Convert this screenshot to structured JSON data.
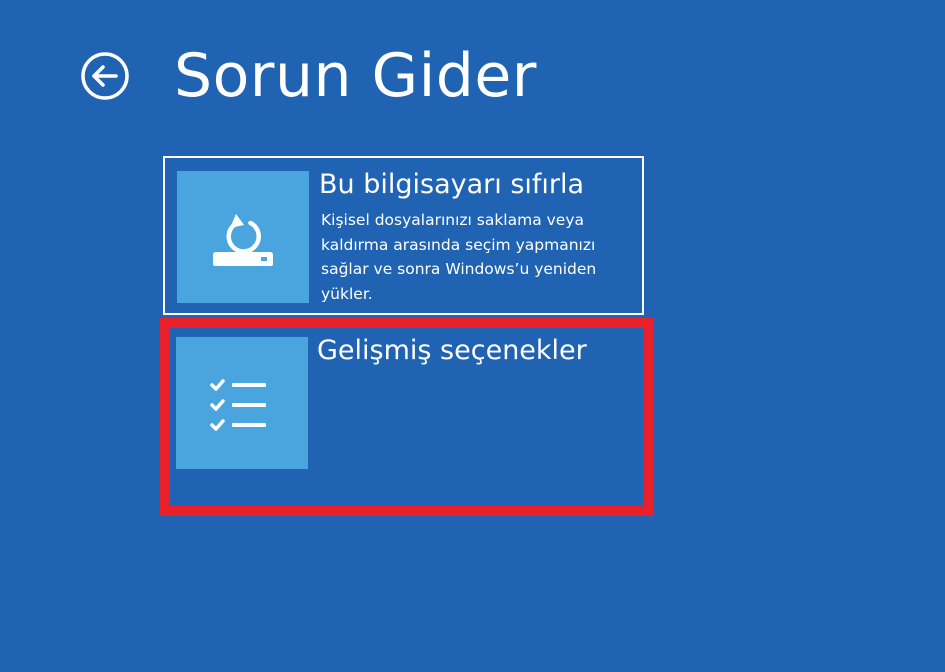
{
  "header": {
    "title": "Sorun Gider",
    "back_icon": "back-arrow-icon"
  },
  "options": [
    {
      "title": "Bu bilgisayarı sıfırla",
      "description": "Kişisel dosyalarınızı saklama veya kaldırma arasında seçim yapmanızı sağlar ve sonra Windows’u yeniden yükler.",
      "icon": "reset-pc-icon",
      "selected": true
    },
    {
      "title": "Gelişmiş seçenekler",
      "description": "",
      "icon": "checklist-icon",
      "selected": false
    }
  ],
  "colors": {
    "background": "#1f63b2",
    "tile_icon_bg": "#4aa5df",
    "text": "#ffffff",
    "highlight": "#e8202a"
  }
}
